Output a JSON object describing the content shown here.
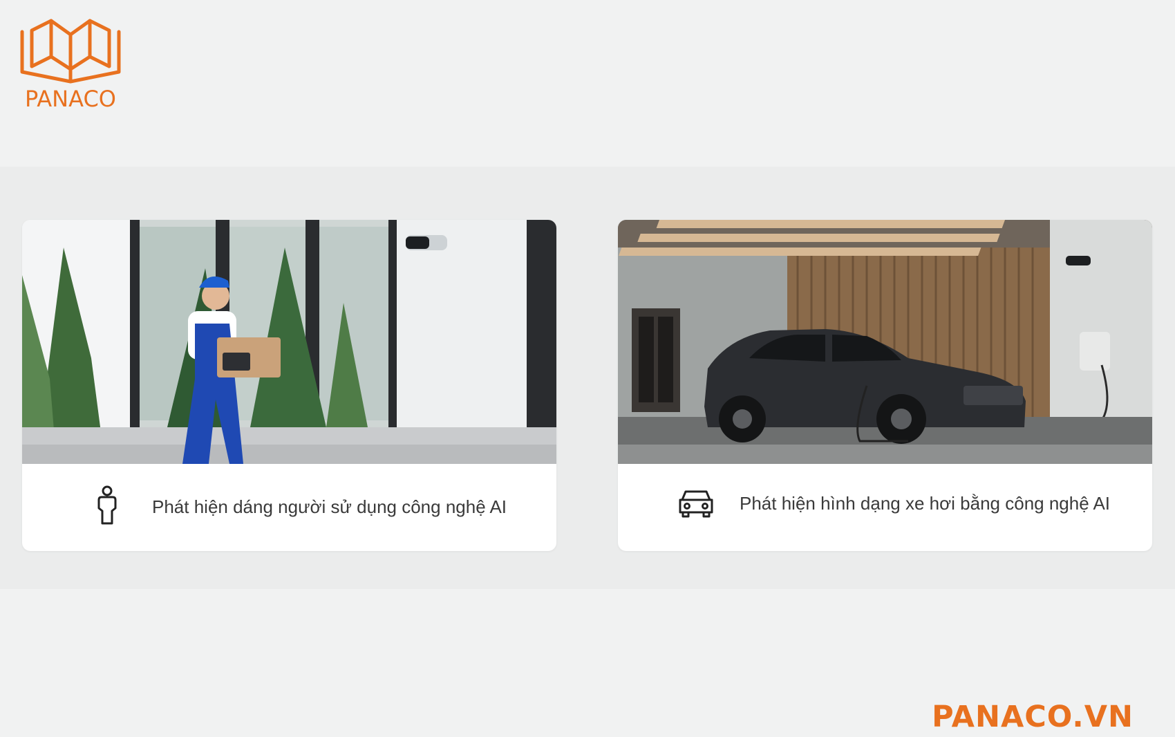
{
  "brand": {
    "logo_text": "PANACO",
    "footer_text": "PANACO.VN",
    "accent_color": "#e8711f"
  },
  "cards": [
    {
      "image": "delivery-man-at-door-photo",
      "icon": "person-icon",
      "text": "Phát hiện dáng người sử dụng công nghệ AI"
    },
    {
      "image": "car-in-garage-photo",
      "icon": "car-icon",
      "text": "Phát hiện hình dạng xe hơi bằng công nghệ AI"
    }
  ]
}
